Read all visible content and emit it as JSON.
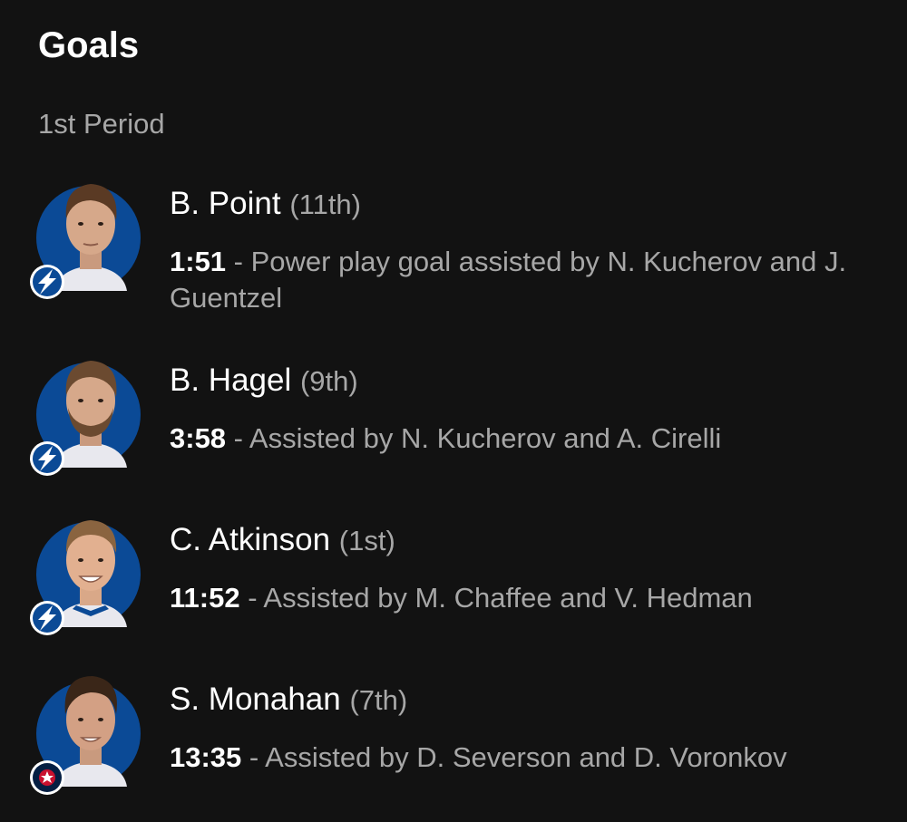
{
  "header": {
    "title": "Goals"
  },
  "period": {
    "label": "1st Period"
  },
  "goals": [
    {
      "scorer": "B. Point",
      "goal_count": "(11th)",
      "time": "1:51",
      "separator": " - ",
      "description": "Power play goal assisted by N. Kucherov and J. Guentzel",
      "team_icon": "lightning-logo-icon"
    },
    {
      "scorer": "B. Hagel",
      "goal_count": "(9th)",
      "time": "3:58",
      "separator": " - ",
      "description": "Assisted by N. Kucherov and A. Cirelli",
      "team_icon": "lightning-logo-icon"
    },
    {
      "scorer": "C. Atkinson",
      "goal_count": "(1st)",
      "time": "11:52",
      "separator": " - ",
      "description": "Assisted by M. Chaffee and V. Hedman",
      "team_icon": "lightning-logo-icon"
    },
    {
      "scorer": "S. Monahan",
      "goal_count": "(7th)",
      "time": "13:35",
      "separator": " - ",
      "description": "Assisted by D. Severson and D. Voronkov",
      "team_icon": "blue-jackets-logo-icon"
    }
  ],
  "colors": {
    "background": "#121212",
    "primary_text": "#ffffff",
    "secondary_text": "#a7a7a7",
    "lightning_blue": "#0b4a96",
    "blue_jackets_navy": "#041e42",
    "blue_jackets_red": "#c8102e"
  }
}
